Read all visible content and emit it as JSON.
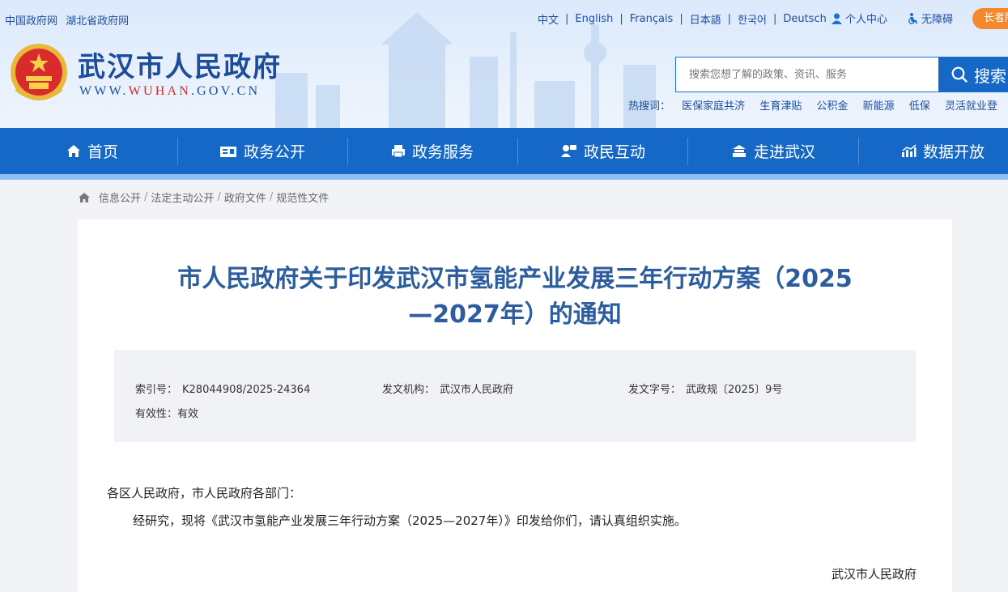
{
  "header": {
    "top_links": [
      "中国政府网",
      "湖北省政府网"
    ],
    "languages": [
      "中文",
      "English",
      "Français",
      "日本語",
      "한국어",
      "Deutsch"
    ],
    "user_center": "个人中心",
    "accessibility": "无障碍",
    "elder_mode": "长者版",
    "site_name": "武汉市人民政府",
    "site_url_prefix": "WWW.",
    "site_url_highlight": "WUHAN",
    "site_url_suffix": ".GOV.CN",
    "search": {
      "placeholder": "搜索您想了解的政策、资讯、服务",
      "button": "搜索"
    },
    "hot_label": "热搜词：",
    "hot_words": [
      "医保家庭共济",
      "生育津贴",
      "公积金",
      "新能源",
      "低保",
      "灵活就业登"
    ]
  },
  "nav": {
    "items": [
      {
        "label": "首页",
        "icon": "home-icon"
      },
      {
        "label": "政务公开",
        "icon": "document-card-icon"
      },
      {
        "label": "政务服务",
        "icon": "printer-icon"
      },
      {
        "label": "政民互动",
        "icon": "interaction-icon"
      },
      {
        "label": "走进武汉",
        "icon": "building-icon"
      },
      {
        "label": "数据开放",
        "icon": "chart-icon"
      }
    ]
  },
  "breadcrumb": [
    "信息公开",
    "法定主动公开",
    "政府文件",
    "规范性文件"
  ],
  "article": {
    "title_line1": "市人民政府关于印发武汉市氢能产业发展三年行动方案（2025",
    "title_line2": "—2027年）的通知",
    "meta": {
      "index_label": "索引号：",
      "index_value": "K28044908/2025-24364",
      "issuer_label": "发文机构：",
      "issuer_value": "武汉市人民政府",
      "docno_label": "发文字号：",
      "docno_value": "武政规〔2025〕9号",
      "validity_label": "有效性：",
      "validity_value": "有效"
    },
    "salutation": "各区人民政府，市人民政府各部门：",
    "paragraph": "经研究，现将《武汉市氢能产业发展三年行动方案（2025—2027年）》印发给你们，请认真组织实施。",
    "signature": "武汉市人民政府"
  },
  "colors": {
    "brand_blue": "#1568c6",
    "title_blue": "#2c5d9e",
    "elder_orange": "#f6882c",
    "url_red": "#d12b2b"
  }
}
